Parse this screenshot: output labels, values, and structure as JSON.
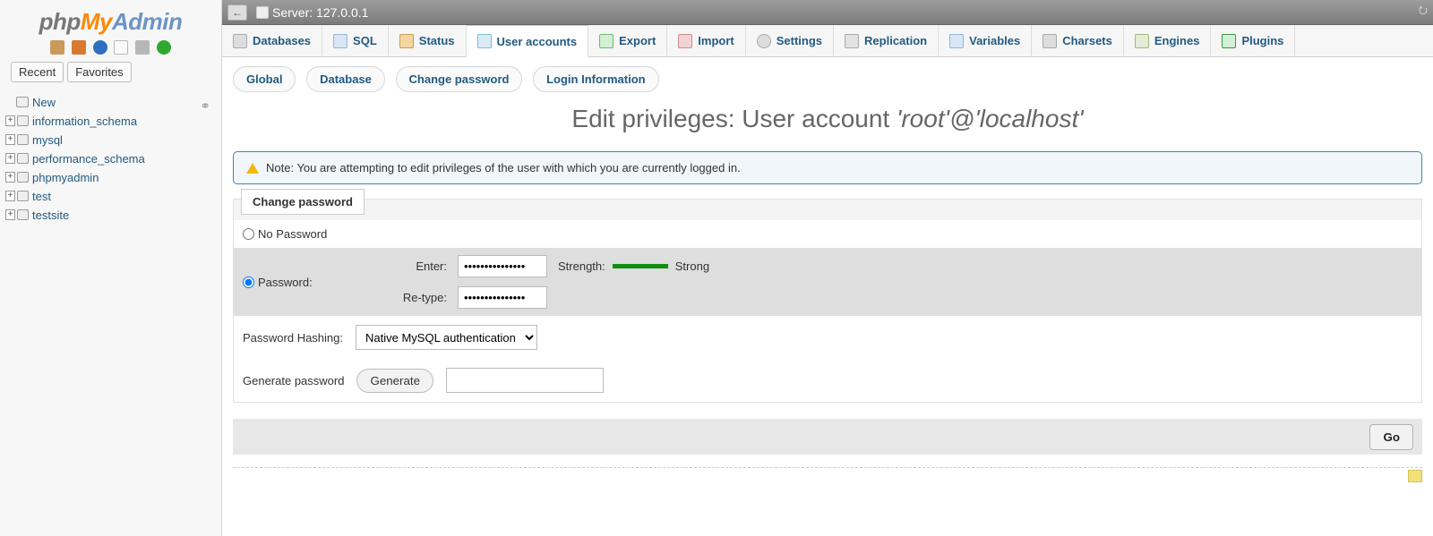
{
  "logo": {
    "p1": "php",
    "p2": "My",
    "p3": "Admin"
  },
  "sidebar": {
    "recent": "Recent",
    "favorites": "Favorites",
    "new": "New",
    "databases": [
      "information_schema",
      "mysql",
      "performance_schema",
      "phpmyadmin",
      "test",
      "testsite"
    ]
  },
  "server": {
    "label": "Server:",
    "name": "127.0.0.1"
  },
  "toptabs": {
    "databases": "Databases",
    "sql": "SQL",
    "status": "Status",
    "user_accounts": "User accounts",
    "export": "Export",
    "import": "Import",
    "settings": "Settings",
    "replication": "Replication",
    "variables": "Variables",
    "charsets": "Charsets",
    "engines": "Engines",
    "plugins": "Plugins"
  },
  "subtabs": {
    "global": "Global",
    "database": "Database",
    "change_password": "Change password",
    "login_information": "Login Information"
  },
  "title_prefix": "Edit privileges: User account ",
  "title_account": "'root'@'localhost'",
  "note": "Note: You are attempting to edit privileges of the user with which you are currently logged in.",
  "form": {
    "legend": "Change password",
    "no_password": "No Password",
    "password": "Password:",
    "enter": "Enter:",
    "retype": "Re-type:",
    "enter_value": "•••••••••••••••",
    "retype_value": "•••••••••••••••",
    "strength_label": "Strength:",
    "strength_value": "Strong",
    "hashing_label": "Password Hashing:",
    "hashing_value": "Native MySQL authentication",
    "generate_label": "Generate password",
    "generate_btn": "Generate",
    "go": "Go"
  }
}
